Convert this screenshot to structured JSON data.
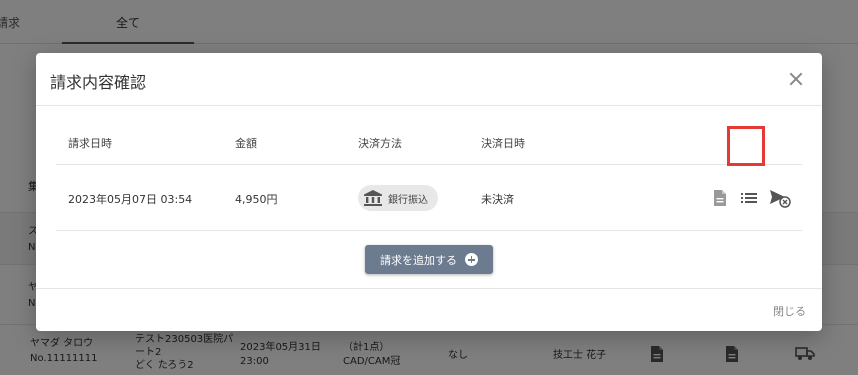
{
  "background": {
    "tabs": {
      "partial": "請求",
      "active": "全て"
    },
    "side_labels": [
      "集",
      "ス",
      "N",
      "ヤ",
      "N"
    ],
    "row": {
      "name": "ヤマダ タロウ",
      "number": "No.11111111",
      "clinic_line1": "テスト230503医院パ",
      "clinic_line2": "ート2",
      "clinic_line3": "どく たろう2",
      "date_line1": "2023年05月31日",
      "date_line2": "23:00",
      "items_line1": "（計1点）",
      "items_line2": "CAD/CAM冠",
      "none": "なし",
      "technician": "技工士 花子"
    },
    "icons": [
      "document-icon",
      "document-icon",
      "truck-icon"
    ]
  },
  "modal": {
    "title": "請求内容確認",
    "columns": [
      "請求日時",
      "金額",
      "決済方法",
      "決済日時"
    ],
    "row": {
      "date": "2023年05月07日 03:54",
      "amount": "4,950円",
      "payment_method": "銀行振込",
      "payment_status": "未決済"
    },
    "row_icons": [
      "document-icon",
      "list-icon",
      "send-cancel-icon"
    ],
    "add_button": "請求を追加する",
    "close_link": "閉じる"
  },
  "colors": {
    "accent_button": "#6c7b8f",
    "highlight": "#e53935"
  }
}
